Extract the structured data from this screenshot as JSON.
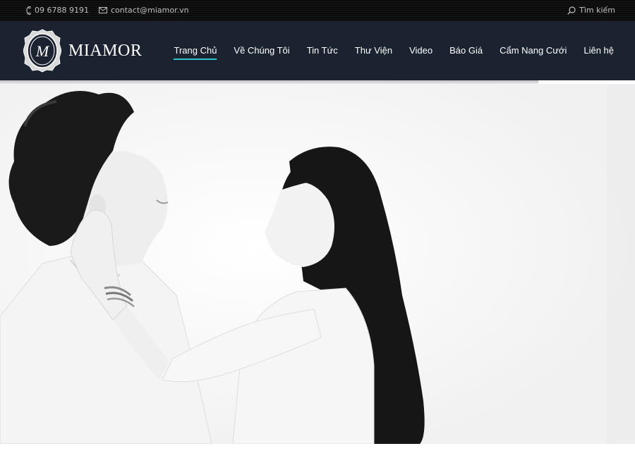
{
  "topbar": {
    "phone": "09 6788 9191",
    "email": "contact@miamor.vn",
    "search_label": "Tìm kiếm",
    "icons": {
      "phone": "phone-icon",
      "email": "mail-icon",
      "search": "search-icon"
    }
  },
  "brand": {
    "name": "MIAMOR",
    "emblem_letter": "M"
  },
  "nav": {
    "items": [
      {
        "label": "Trang Chủ",
        "active": true
      },
      {
        "label": "Về Chúng Tôi"
      },
      {
        "label": "Tin Tức"
      },
      {
        "label": "Thư Viện"
      },
      {
        "label": "Video"
      },
      {
        "label": "Báo Giá"
      },
      {
        "label": "Cẩm Nang Cưới"
      },
      {
        "label": "Liên hệ"
      }
    ]
  },
  "colors": {
    "topbar_bg": "#0b0b0b",
    "header_bg": "#1b2230",
    "active_underline": "#2ec3cf",
    "text_light": "#ffffff",
    "text_muted": "#bfbfbf"
  },
  "hero": {
    "image": "black-and-white-couple-photo"
  }
}
